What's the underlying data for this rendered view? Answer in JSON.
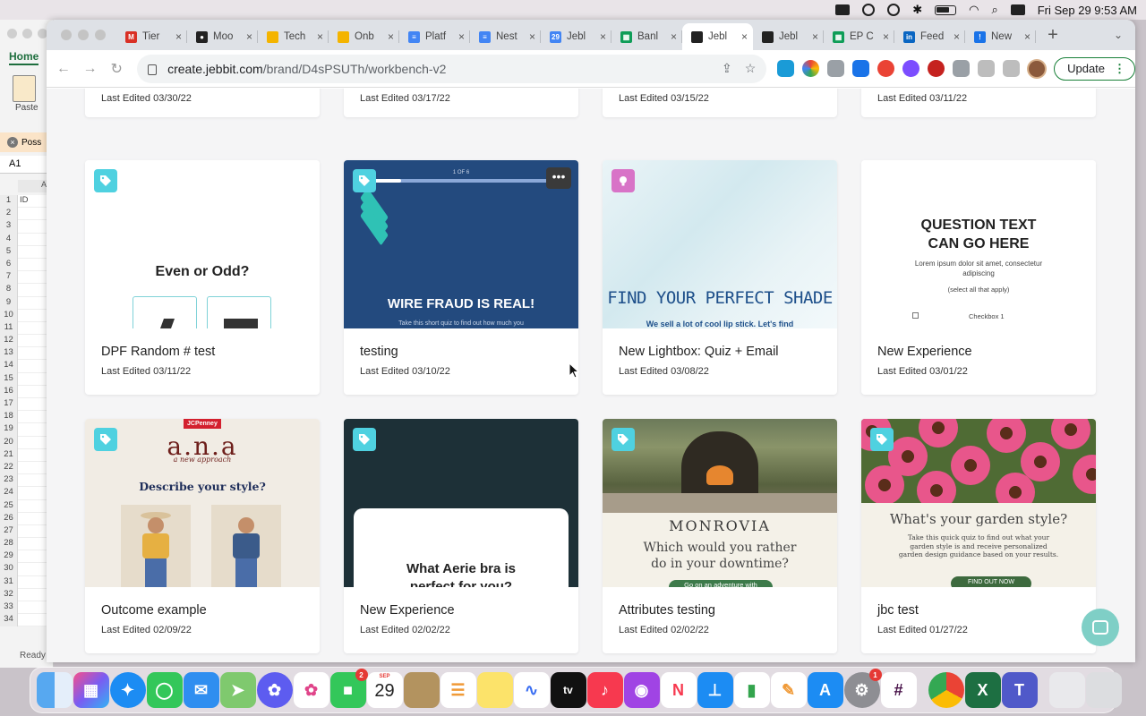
{
  "menubar": {
    "datetime": "Fri Sep 29  9:53 AM"
  },
  "excel": {
    "tab_home": "Home",
    "paste_label": "Paste",
    "warning_text": "Poss",
    "cell_ref": "A1",
    "col_header": "A",
    "row1_value": "ID",
    "row_numbers": [
      "1",
      "2",
      "3",
      "4",
      "5",
      "6",
      "7",
      "8",
      "9",
      "10",
      "11",
      "12",
      "13",
      "14",
      "15",
      "16",
      "17",
      "18",
      "19",
      "20",
      "21",
      "22",
      "23",
      "24",
      "25",
      "26",
      "27",
      "28",
      "29",
      "30",
      "31",
      "32",
      "33",
      "34"
    ],
    "status": "Ready"
  },
  "browser": {
    "tabs": [
      {
        "title": "Tier",
        "color": "#d93025",
        "glyph": "M"
      },
      {
        "title": "Moo",
        "color": "#222222",
        "glyph": "●"
      },
      {
        "title": "Tech",
        "color": "#f4b400",
        "glyph": ""
      },
      {
        "title": "Onb",
        "color": "#f4b400",
        "glyph": ""
      },
      {
        "title": "Platf",
        "color": "#4285f4",
        "glyph": "≡"
      },
      {
        "title": "Nest",
        "color": "#4285f4",
        "glyph": "≡"
      },
      {
        "title": "Jebl",
        "color": "#4285f4",
        "glyph": "29"
      },
      {
        "title": "Banl",
        "color": "#0f9d58",
        "glyph": "▦"
      },
      {
        "title": "Jebl",
        "color": "#222222",
        "glyph": "",
        "active": true
      },
      {
        "title": "Jebl",
        "color": "#222222",
        "glyph": ""
      },
      {
        "title": "EP C",
        "color": "#0f9d58",
        "glyph": "▦"
      },
      {
        "title": "Feed",
        "color": "#0a66c2",
        "glyph": "in"
      },
      {
        "title": "New",
        "color": "#1a73e8",
        "glyph": "!"
      }
    ],
    "url_host": "create.jebbit.com",
    "url_path": "/brand/D4sPSUTh/workbench-v2",
    "update_label": "Update"
  },
  "cards_top_row": [
    {
      "date": "Last Edited 03/30/22"
    },
    {
      "date": "Last Edited 03/17/22"
    },
    {
      "date": "Last Edited 03/15/22"
    },
    {
      "date": "Last Edited 03/11/22"
    }
  ],
  "cards": [
    {
      "name": "DPF Random # test",
      "date": "Last Edited 03/11/22",
      "thumb": {
        "question": "Even or Odd?"
      }
    },
    {
      "name": "testing",
      "date": "Last Edited 03/10/22",
      "thumb": {
        "progress": "1 OF 6",
        "headline": "WIRE FRAUD IS REAL!",
        "sub": "Take this short quiz to find out how much you"
      }
    },
    {
      "name": "New Lightbox: Quiz + Email",
      "date": "Last Edited 03/08/22",
      "thumb": {
        "headline": "FIND YOUR PERFECT SHADE",
        "sub": "We sell a lot of cool lip stick.  Let's find"
      }
    },
    {
      "name": "New Experience",
      "date": "Last Edited 03/01/22",
      "thumb": {
        "question": "QUESTION TEXT CAN GO HERE",
        "lorem": "Lorem ipsum dolor sit amet, consectetur adipiscing",
        "select": "(select all that apply)",
        "checkbox": "Checkbox 1"
      }
    },
    {
      "name": "Outcome example",
      "date": "Last Edited 02/09/22",
      "thumb": {
        "badge": "JCPenney",
        "logo": "a.n.a",
        "tagline": "a new approach",
        "question": "Describe your style?"
      }
    },
    {
      "name": "New Experience",
      "date": "Last Edited 02/02/22",
      "thumb": {
        "question": "What Aerie bra is perfect for you?"
      }
    },
    {
      "name": "Attributes testing",
      "date": "Last Edited 02/02/22",
      "thumb": {
        "brand": "MONROVIA",
        "question": "Which would you rather do in your downtime?",
        "button": "Go on an adventure with"
      }
    },
    {
      "name": "jbc test",
      "date": "Last Edited 01/27/22",
      "thumb": {
        "question": "What's your garden style?",
        "text": "Take this quick quiz to find out what your garden style is and receive personalized garden design guidance based on your results.",
        "button": "FIND OUT NOW"
      }
    }
  ],
  "dock": {
    "facetime_badge": "2",
    "calendar_month": "SEP",
    "calendar_day": "29",
    "settings_badge": "1",
    "apple_tv_label": "tv"
  }
}
